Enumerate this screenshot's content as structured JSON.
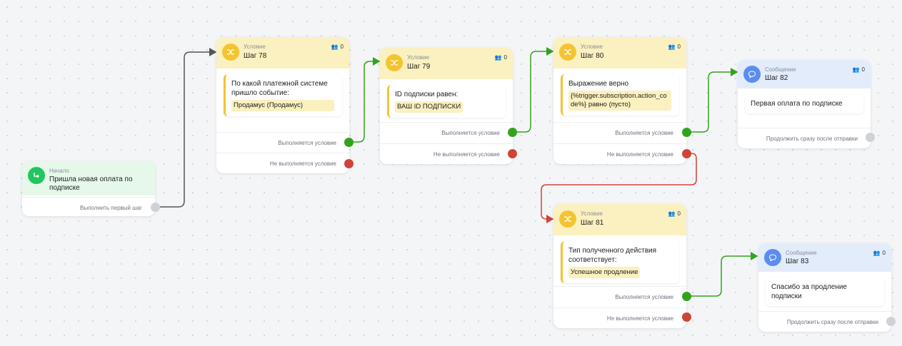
{
  "colors": {
    "condition": "#f4c430",
    "message": "#5b8def",
    "start": "#22c55e",
    "true_edge": "#33a31f",
    "false_edge": "#cf4438"
  },
  "start_node": {
    "type_label": "Начало",
    "title": "Пришла новая оплата по подписке",
    "output": "Выполнить первый шаг",
    "icon": "arrow-turn-icon"
  },
  "nodes": {
    "step78": {
      "type_label": "Условие",
      "title": "Шаг 78",
      "count": "0",
      "text": "По какой платежной системе пришло событие:",
      "chip": "Продамус (Продамус)",
      "true_label": "Выполняется условие",
      "false_label": "Не выполняется условие"
    },
    "step79": {
      "type_label": "Условие",
      "title": "Шаг 79",
      "count": "0",
      "text": "ID подписки равен:",
      "chip": "ВАШ ID ПОДПИСКИ",
      "true_label": "Выполняется условие",
      "false_label": "Не выполняется условие"
    },
    "step80": {
      "type_label": "Условие",
      "title": "Шаг 80",
      "count": "0",
      "text": "Выражение верно",
      "chip": "{%trigger.subscription.action_code%} равно (пусто)",
      "true_label": "Выполняется условие",
      "false_label": "Не выполняется условие"
    },
    "step81": {
      "type_label": "Условие",
      "title": "Шаг 81",
      "count": "0",
      "text": "Тип полученного действия соответствует:",
      "chip": "Успешное продление",
      "true_label": "Выполняется условие",
      "false_label": "Не выполняется условие"
    },
    "step82": {
      "type_label": "Сообщение",
      "title": "Шаг 82",
      "count": "0",
      "text": "Первая оплата по подписке",
      "output": "Продолжить сразу после отправки"
    },
    "step83": {
      "type_label": "Сообщение",
      "title": "Шаг 83",
      "count": "0",
      "text": "Спасибо за продление подписки",
      "output": "Продолжить сразу после отправки"
    }
  }
}
